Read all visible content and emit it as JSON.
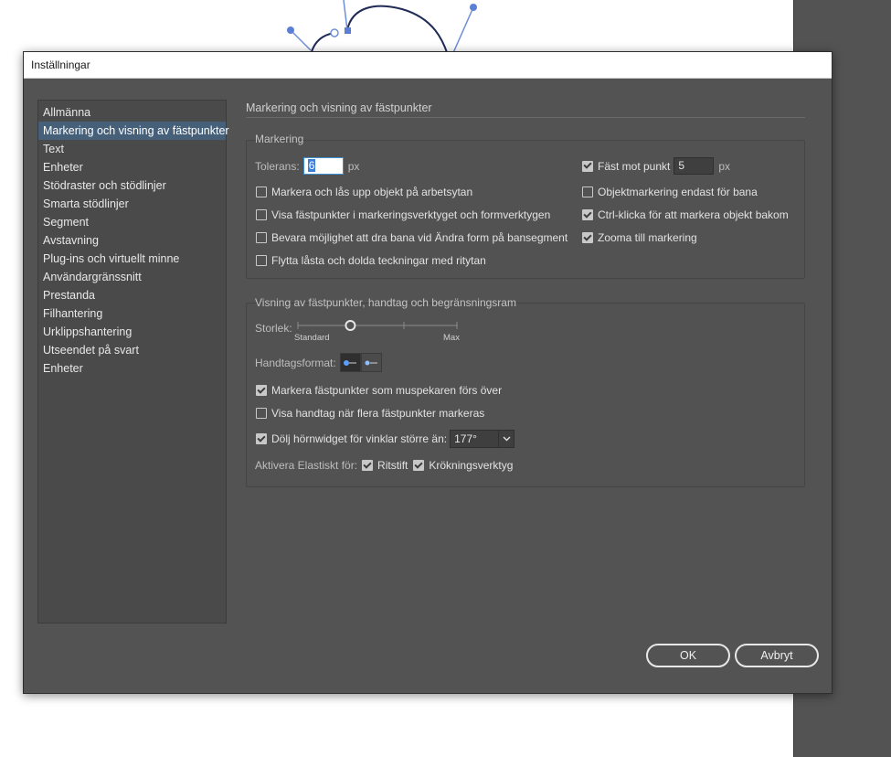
{
  "dialog": {
    "title": "Inställningar"
  },
  "sidebar": {
    "items": [
      {
        "label": "Allmänna",
        "active": false
      },
      {
        "label": "Markering och visning av fästpunkter",
        "active": true
      },
      {
        "label": "Text",
        "active": false
      },
      {
        "label": "Enheter",
        "active": false
      },
      {
        "label": "Stödraster och stödlinjer",
        "active": false
      },
      {
        "label": "Smarta stödlinjer",
        "active": false
      },
      {
        "label": "Segment",
        "active": false
      },
      {
        "label": "Avstavning",
        "active": false
      },
      {
        "label": "Plug-ins och virtuellt minne",
        "active": false
      },
      {
        "label": "Användargränssnitt",
        "active": false
      },
      {
        "label": "Prestanda",
        "active": false
      },
      {
        "label": "Filhantering",
        "active": false
      },
      {
        "label": "Urklippshantering",
        "active": false
      },
      {
        "label": "Utseendet på svart",
        "active": false
      },
      {
        "label": "Enheter",
        "active": false
      }
    ]
  },
  "section": {
    "title": "Markering och visning av fästpunkter"
  },
  "markering": {
    "title": "Markering",
    "tolerans_label": "Tolerans:",
    "tolerans_value": "6",
    "tolerans_unit": "px",
    "snap_label": "Fäst mot punkt",
    "snap_checked": true,
    "snap_value": "5",
    "snap_unit": "px",
    "left_options": [
      {
        "label": "Markera och lås upp objekt på arbetsytan",
        "checked": false
      },
      {
        "label": "Visa fästpunkter i markeringsverktyget och formverktygen",
        "checked": false
      },
      {
        "label": "Bevara möjlighet att dra bana vid Ändra form på bansegment",
        "checked": false
      },
      {
        "label": "Flytta låsta och dolda teckningar med ritytan",
        "checked": false
      }
    ],
    "right_options": [
      {
        "label": "Objektmarkering endast för bana",
        "checked": false
      },
      {
        "label": "Ctrl-klicka för att markera objekt bakom",
        "checked": true
      },
      {
        "label": "Zooma till markering",
        "checked": true
      }
    ]
  },
  "visning": {
    "title": "Visning av fästpunkter, handtag och begränsningsram",
    "size_label": "Storlek:",
    "slider_min_label": "Standard",
    "slider_max_label": "Max",
    "slider_value": 0.33,
    "handle_format_label": "Handtagsformat:",
    "options": [
      {
        "label": "Markera fästpunkter som muspekaren förs över",
        "checked": true
      },
      {
        "label": "Visa handtag när flera fästpunkter markeras",
        "checked": false
      }
    ],
    "hide_corner_label": "Dölj hörnwidget för vinklar större än:",
    "hide_corner_checked": true,
    "hide_corner_value": "177°",
    "elastic_label": "Aktivera Elastiskt för:",
    "elastic_pen_label": "Ritstift",
    "elastic_pen_checked": true,
    "elastic_curve_label": "Krökningsverktyg",
    "elastic_curve_checked": true
  },
  "buttons": {
    "ok": "OK",
    "cancel": "Avbryt"
  },
  "colors": {
    "accent": "#3b7dd8",
    "dialog_bg": "#535353",
    "selection": "#46607a"
  }
}
